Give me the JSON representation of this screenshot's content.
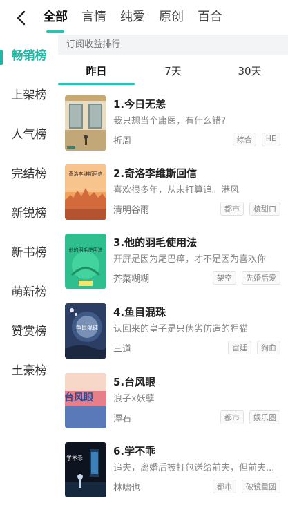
{
  "top_tabs": [
    "全部",
    "言情",
    "纯爱",
    "原创",
    "百合"
  ],
  "active_top_tab": 0,
  "sidebar": {
    "items": [
      "畅销榜",
      "上架榜",
      "人气榜",
      "完结榜",
      "新锐榜",
      "新书榜",
      "萌新榜",
      "赞赏榜",
      "土豪榜"
    ],
    "active": 0
  },
  "subheader": "订阅收益排行",
  "periods": [
    "昨日",
    "7天",
    "30天"
  ],
  "active_period": 0,
  "books": [
    {
      "title": "1.今日无恙",
      "desc": "我只想当个庸医，有什么错?",
      "author": "折周",
      "tags": [
        "综合",
        "HE"
      ],
      "cover_text": ""
    },
    {
      "title": "2.奇洛李维斯回信",
      "desc": "喜欢很多年，从未打算追。港风",
      "author": "清明谷雨",
      "tags": [
        "都市",
        "棱甜口"
      ],
      "cover_text": "奇洛李维斯回信"
    },
    {
      "title": "3.他的羽毛使用法",
      "desc": "开屏是因为尾巴痒，才不是因为喜欢你",
      "author": "芥菜糊糊",
      "tags": [
        "架空",
        "先婚后爱"
      ],
      "cover_text": "他的羽毛使用法"
    },
    {
      "title": "4.鱼目混珠",
      "desc": "认回来的皇子是只伪劣仿造的狸猫",
      "author": "三道",
      "tags": [
        "宫廷",
        "狗血"
      ],
      "cover_text": "鱼目混珠"
    },
    {
      "title": "5.台风眼",
      "desc": "浪子x妖孽",
      "author": "潭石",
      "tags": [
        "都市",
        "娱乐圈"
      ],
      "cover_text": "台风眼"
    },
    {
      "title": "6.学不乖",
      "desc": "追夫，离婚后被打包送给前夫，但前夫...",
      "author": "林啸也",
      "tags": [
        "都市",
        "破镜重圆"
      ],
      "cover_text": "学不乖"
    }
  ]
}
